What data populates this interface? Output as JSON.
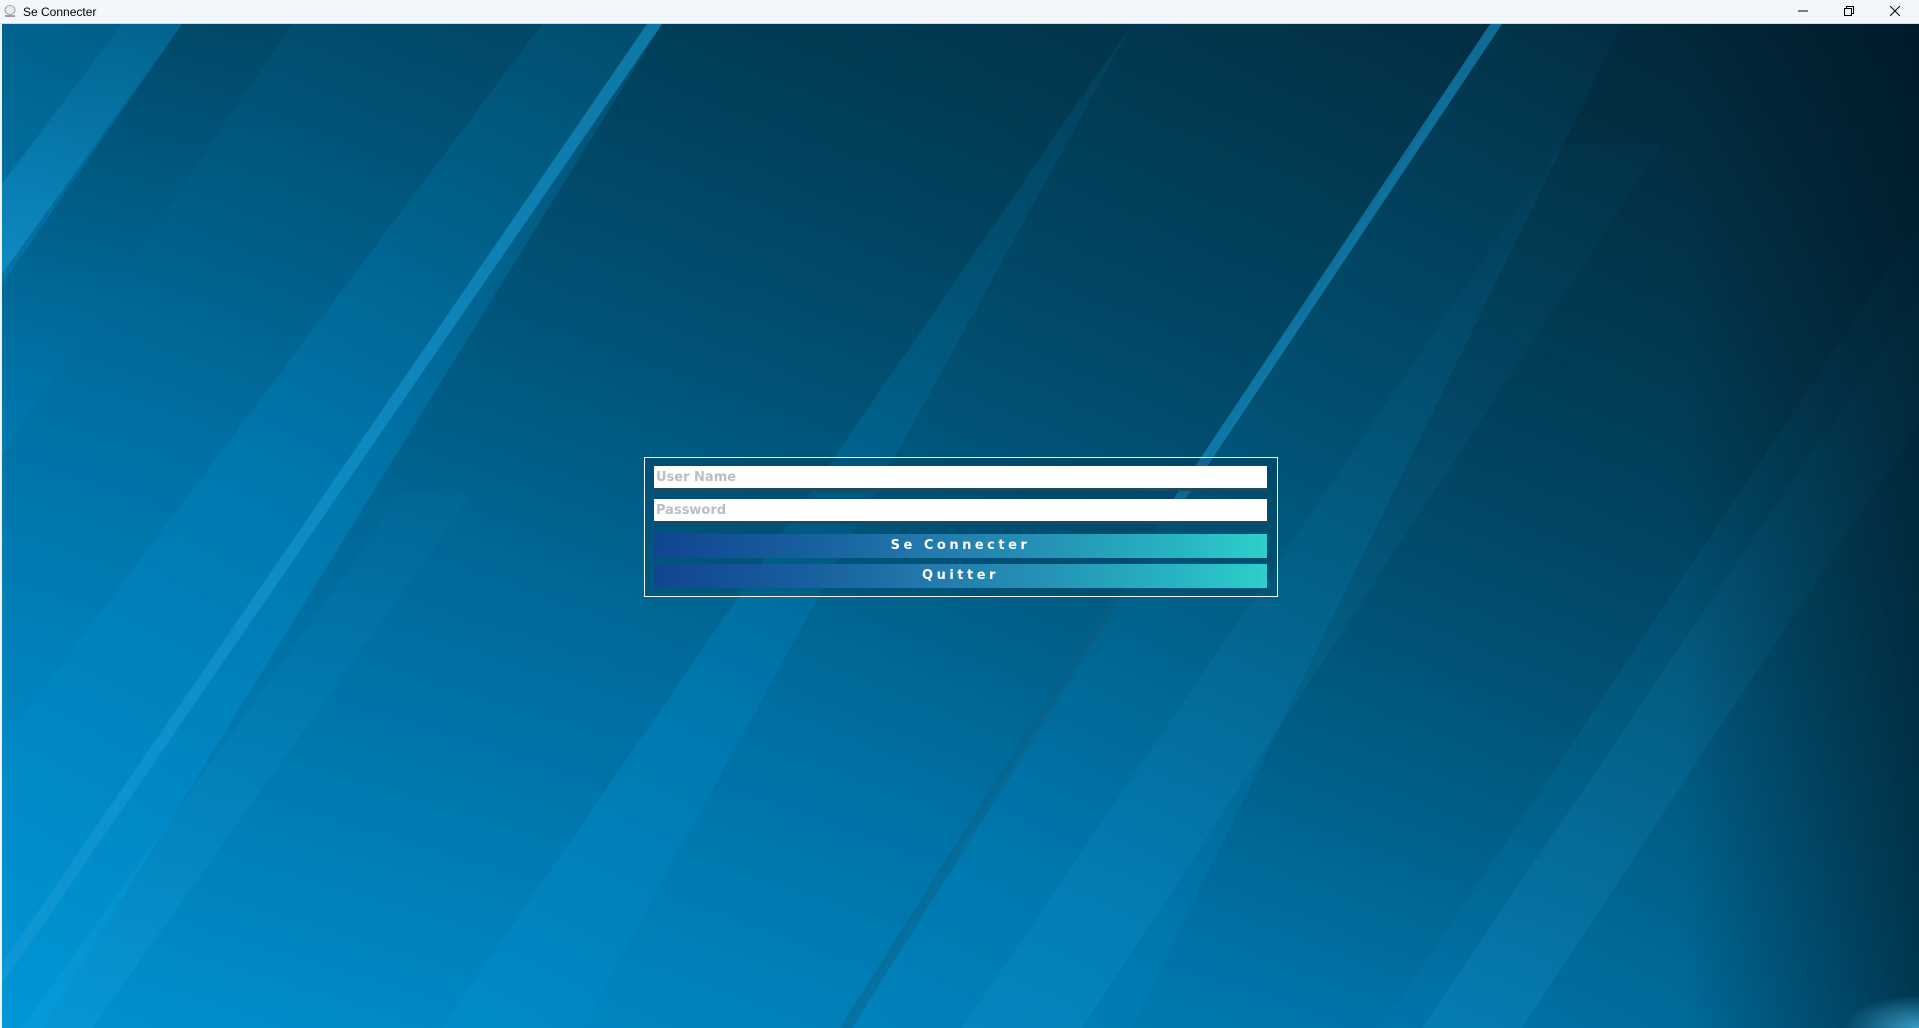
{
  "window": {
    "title": "Se Connecter",
    "app_icon": "app-icon",
    "controls": {
      "minimize_icon": "minimize-icon",
      "maximize_icon": "restore-icon",
      "close_icon": "close-icon"
    }
  },
  "login": {
    "username": {
      "value": "",
      "placeholder": "User Name"
    },
    "password": {
      "value": "",
      "placeholder": "Password"
    },
    "connect_label": "Se Connecter",
    "quit_label": "Quitter"
  },
  "colors": {
    "background_dark": "#022a3c",
    "background_light": "#0092d6",
    "button_gradient_start": "#124591",
    "button_gradient_end": "#2ecfcb",
    "panel_border": "#f2f6f8"
  }
}
